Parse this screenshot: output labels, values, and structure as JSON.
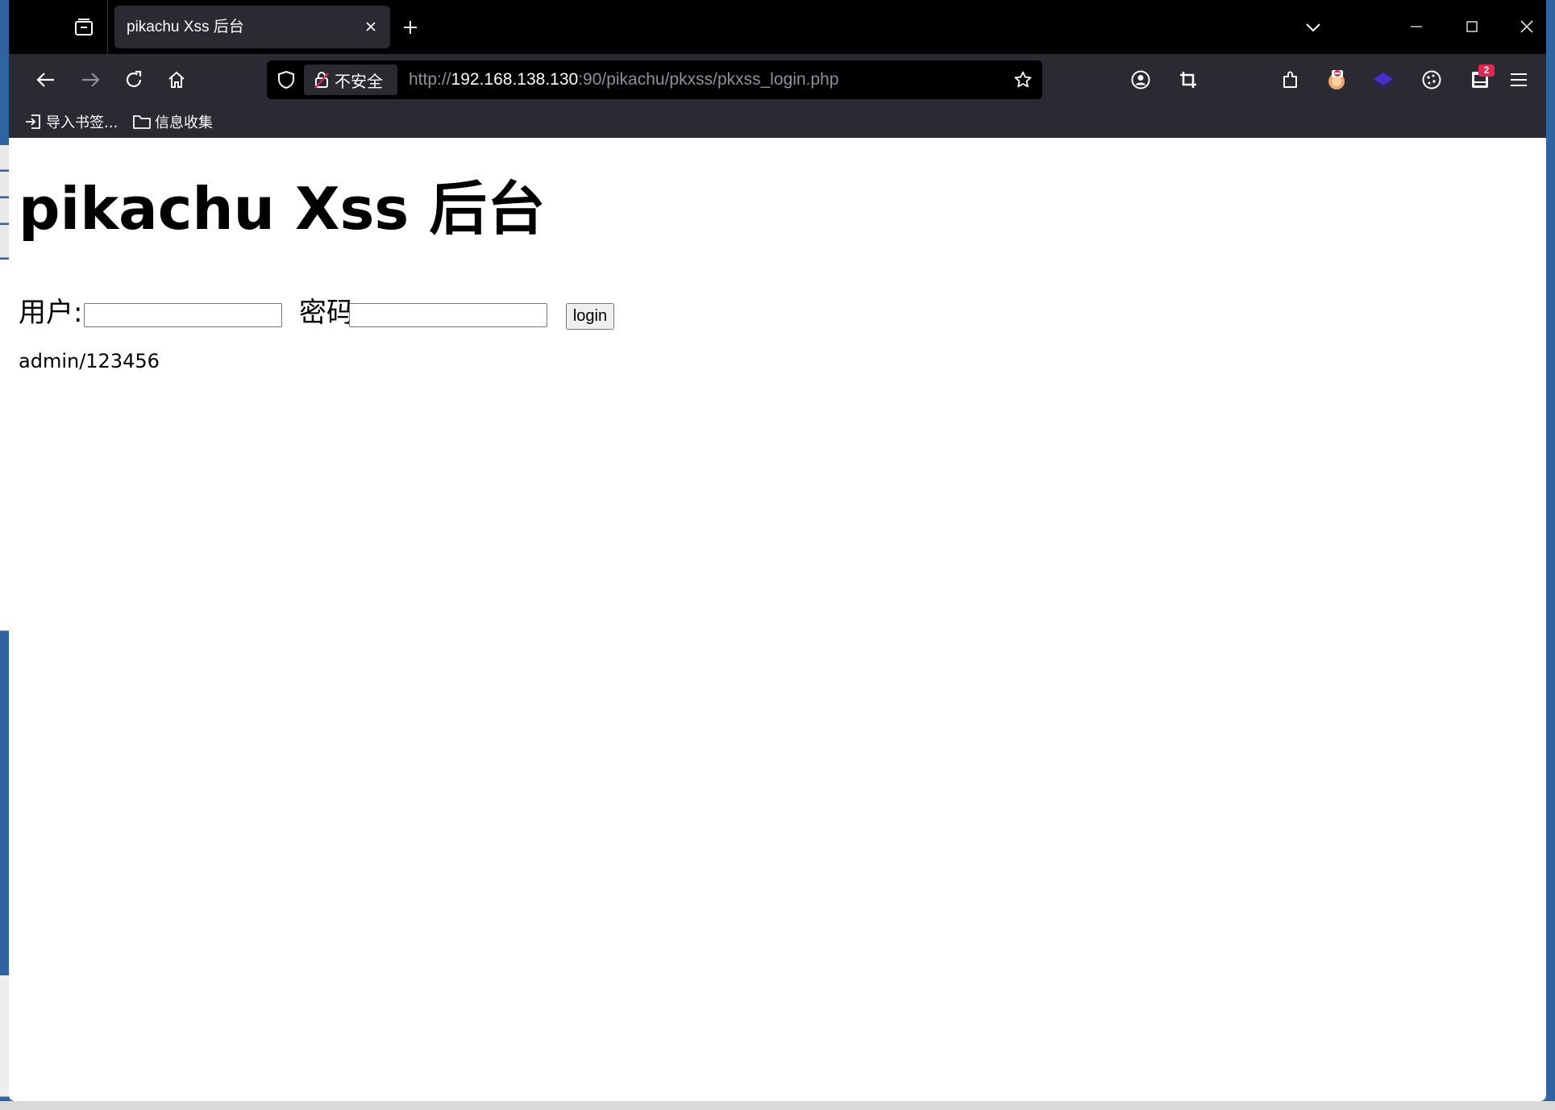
{
  "browser": {
    "tab": {
      "title": "pikachu Xss 后台"
    },
    "address": {
      "security_label": "不安全",
      "url_scheme": "http://",
      "url_host": "192.168.138.130",
      "url_rest": ":90/pikachu/pkxss/pkxss_login.php"
    },
    "extensions": {
      "badge_count": "2"
    },
    "bookmarks": [
      {
        "label": "导入书签...",
        "icon": "import-icon"
      },
      {
        "label": "信息收集",
        "icon": "folder-icon"
      }
    ]
  },
  "page": {
    "title": "pikachu Xss 后台",
    "form": {
      "username_label": "用户:",
      "username_value": "",
      "password_label": "密码",
      "password_value": "",
      "submit_label": "login"
    },
    "hint": "admin/123456"
  }
}
